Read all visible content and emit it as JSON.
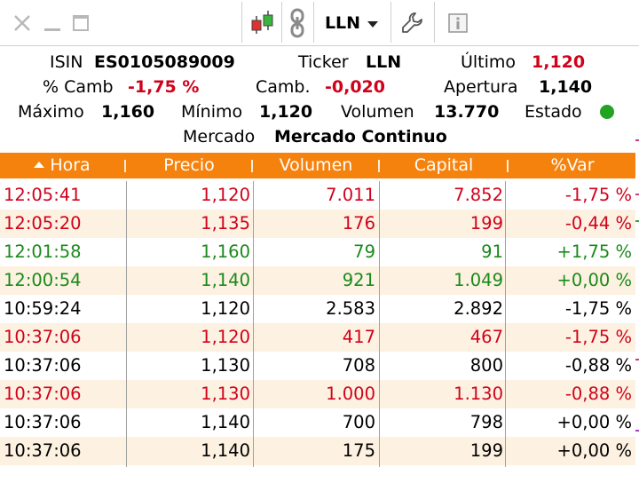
{
  "toolbar": {
    "ticker": "LLN",
    "icons": [
      "close-icon",
      "minimize-icon",
      "maximize-icon",
      "candlestick-icon",
      "link-icon",
      "wrench-icon",
      "info-icon"
    ]
  },
  "summary": {
    "isin_label": "ISIN",
    "isin": "ES0105089009",
    "ticker_label": "Ticker",
    "ticker": "LLN",
    "ultimo_label": "Último",
    "ultimo": "1,120",
    "pcamb_label": "% Camb",
    "pcamb": "-1,75 %",
    "camb_label": "Camb.",
    "camb": "-0,020",
    "apertura_label": "Apertura",
    "apertura": "1,140",
    "maximo_label": "Máximo",
    "maximo": "1,160",
    "minimo_label": "Mínimo",
    "minimo": "1,120",
    "volumen_label": "Volumen",
    "volumen": "13.770",
    "estado_label": "Estado",
    "mercado_label": "Mercado",
    "mercado": "Mercado Continuo"
  },
  "table": {
    "headers": [
      "Hora",
      "Precio",
      "Volumen",
      "Capital",
      "%Var"
    ],
    "rows": [
      {
        "hora": "12:05:41",
        "precio": "1,120",
        "volumen": "7.011",
        "capital": "7.852",
        "var": "-1,75 %",
        "color": "red"
      },
      {
        "hora": "12:05:20",
        "precio": "1,135",
        "volumen": "176",
        "capital": "199",
        "var": "-0,44 %",
        "color": "red"
      },
      {
        "hora": "12:01:58",
        "precio": "1,160",
        "volumen": "79",
        "capital": "91",
        "var": "+1,75 %",
        "color": "green"
      },
      {
        "hora": "12:00:54",
        "precio": "1,140",
        "volumen": "921",
        "capital": "1.049",
        "var": "+0,00 %",
        "color": "green"
      },
      {
        "hora": "10:59:24",
        "precio": "1,120",
        "volumen": "2.583",
        "capital": "2.892",
        "var": "-1,75 %",
        "color": "black"
      },
      {
        "hora": "10:37:06",
        "precio": "1,120",
        "volumen": "417",
        "capital": "467",
        "var": "-1,75 %",
        "color": "red"
      },
      {
        "hora": "10:37:06",
        "precio": "1,130",
        "volumen": "708",
        "capital": "800",
        "var": "-0,88 %",
        "color": "black"
      },
      {
        "hora": "10:37:06",
        "precio": "1,130",
        "volumen": "1.000",
        "capital": "1.130",
        "var": "-0,88 %",
        "color": "red"
      },
      {
        "hora": "10:37:06",
        "precio": "1,140",
        "volumen": "700",
        "capital": "798",
        "var": "+0,00 %",
        "color": "black"
      },
      {
        "hora": "10:37:06",
        "precio": "1,140",
        "volumen": "175",
        "capital": "199",
        "var": "+0,00 %",
        "color": "black"
      }
    ]
  },
  "colors": {
    "header_bg": "#f6820e",
    "row_alt": "#fdf1e1",
    "red": "#d0021b",
    "green": "#1a8a1a",
    "status_dot": "#22a322"
  }
}
